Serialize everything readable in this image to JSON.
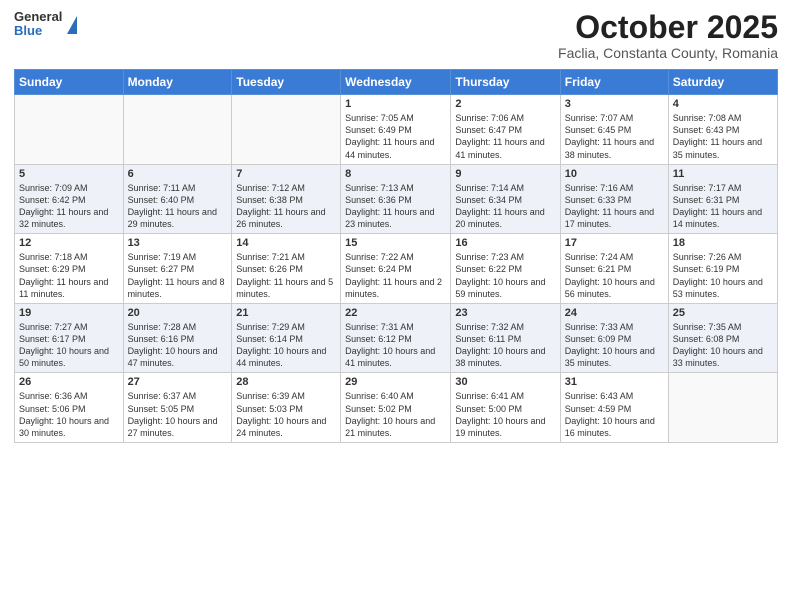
{
  "header": {
    "logo_general": "General",
    "logo_blue": "Blue",
    "title": "October 2025",
    "location": "Faclia, Constanta County, Romania"
  },
  "days_of_week": [
    "Sunday",
    "Monday",
    "Tuesday",
    "Wednesday",
    "Thursday",
    "Friday",
    "Saturday"
  ],
  "weeks": [
    {
      "days": [
        {
          "number": "",
          "sunrise": "",
          "sunset": "",
          "daylight": ""
        },
        {
          "number": "",
          "sunrise": "",
          "sunset": "",
          "daylight": ""
        },
        {
          "number": "",
          "sunrise": "",
          "sunset": "",
          "daylight": ""
        },
        {
          "number": "1",
          "sunrise": "Sunrise: 7:05 AM",
          "sunset": "Sunset: 6:49 PM",
          "daylight": "Daylight: 11 hours and 44 minutes."
        },
        {
          "number": "2",
          "sunrise": "Sunrise: 7:06 AM",
          "sunset": "Sunset: 6:47 PM",
          "daylight": "Daylight: 11 hours and 41 minutes."
        },
        {
          "number": "3",
          "sunrise": "Sunrise: 7:07 AM",
          "sunset": "Sunset: 6:45 PM",
          "daylight": "Daylight: 11 hours and 38 minutes."
        },
        {
          "number": "4",
          "sunrise": "Sunrise: 7:08 AM",
          "sunset": "Sunset: 6:43 PM",
          "daylight": "Daylight: 11 hours and 35 minutes."
        }
      ]
    },
    {
      "days": [
        {
          "number": "5",
          "sunrise": "Sunrise: 7:09 AM",
          "sunset": "Sunset: 6:42 PM",
          "daylight": "Daylight: 11 hours and 32 minutes."
        },
        {
          "number": "6",
          "sunrise": "Sunrise: 7:11 AM",
          "sunset": "Sunset: 6:40 PM",
          "daylight": "Daylight: 11 hours and 29 minutes."
        },
        {
          "number": "7",
          "sunrise": "Sunrise: 7:12 AM",
          "sunset": "Sunset: 6:38 PM",
          "daylight": "Daylight: 11 hours and 26 minutes."
        },
        {
          "number": "8",
          "sunrise": "Sunrise: 7:13 AM",
          "sunset": "Sunset: 6:36 PM",
          "daylight": "Daylight: 11 hours and 23 minutes."
        },
        {
          "number": "9",
          "sunrise": "Sunrise: 7:14 AM",
          "sunset": "Sunset: 6:34 PM",
          "daylight": "Daylight: 11 hours and 20 minutes."
        },
        {
          "number": "10",
          "sunrise": "Sunrise: 7:16 AM",
          "sunset": "Sunset: 6:33 PM",
          "daylight": "Daylight: 11 hours and 17 minutes."
        },
        {
          "number": "11",
          "sunrise": "Sunrise: 7:17 AM",
          "sunset": "Sunset: 6:31 PM",
          "daylight": "Daylight: 11 hours and 14 minutes."
        }
      ]
    },
    {
      "days": [
        {
          "number": "12",
          "sunrise": "Sunrise: 7:18 AM",
          "sunset": "Sunset: 6:29 PM",
          "daylight": "Daylight: 11 hours and 11 minutes."
        },
        {
          "number": "13",
          "sunrise": "Sunrise: 7:19 AM",
          "sunset": "Sunset: 6:27 PM",
          "daylight": "Daylight: 11 hours and 8 minutes."
        },
        {
          "number": "14",
          "sunrise": "Sunrise: 7:21 AM",
          "sunset": "Sunset: 6:26 PM",
          "daylight": "Daylight: 11 hours and 5 minutes."
        },
        {
          "number": "15",
          "sunrise": "Sunrise: 7:22 AM",
          "sunset": "Sunset: 6:24 PM",
          "daylight": "Daylight: 11 hours and 2 minutes."
        },
        {
          "number": "16",
          "sunrise": "Sunrise: 7:23 AM",
          "sunset": "Sunset: 6:22 PM",
          "daylight": "Daylight: 10 hours and 59 minutes."
        },
        {
          "number": "17",
          "sunrise": "Sunrise: 7:24 AM",
          "sunset": "Sunset: 6:21 PM",
          "daylight": "Daylight: 10 hours and 56 minutes."
        },
        {
          "number": "18",
          "sunrise": "Sunrise: 7:26 AM",
          "sunset": "Sunset: 6:19 PM",
          "daylight": "Daylight: 10 hours and 53 minutes."
        }
      ]
    },
    {
      "days": [
        {
          "number": "19",
          "sunrise": "Sunrise: 7:27 AM",
          "sunset": "Sunset: 6:17 PM",
          "daylight": "Daylight: 10 hours and 50 minutes."
        },
        {
          "number": "20",
          "sunrise": "Sunrise: 7:28 AM",
          "sunset": "Sunset: 6:16 PM",
          "daylight": "Daylight: 10 hours and 47 minutes."
        },
        {
          "number": "21",
          "sunrise": "Sunrise: 7:29 AM",
          "sunset": "Sunset: 6:14 PM",
          "daylight": "Daylight: 10 hours and 44 minutes."
        },
        {
          "number": "22",
          "sunrise": "Sunrise: 7:31 AM",
          "sunset": "Sunset: 6:12 PM",
          "daylight": "Daylight: 10 hours and 41 minutes."
        },
        {
          "number": "23",
          "sunrise": "Sunrise: 7:32 AM",
          "sunset": "Sunset: 6:11 PM",
          "daylight": "Daylight: 10 hours and 38 minutes."
        },
        {
          "number": "24",
          "sunrise": "Sunrise: 7:33 AM",
          "sunset": "Sunset: 6:09 PM",
          "daylight": "Daylight: 10 hours and 35 minutes."
        },
        {
          "number": "25",
          "sunrise": "Sunrise: 7:35 AM",
          "sunset": "Sunset: 6:08 PM",
          "daylight": "Daylight: 10 hours and 33 minutes."
        }
      ]
    },
    {
      "days": [
        {
          "number": "26",
          "sunrise": "Sunrise: 6:36 AM",
          "sunset": "Sunset: 5:06 PM",
          "daylight": "Daylight: 10 hours and 30 minutes."
        },
        {
          "number": "27",
          "sunrise": "Sunrise: 6:37 AM",
          "sunset": "Sunset: 5:05 PM",
          "daylight": "Daylight: 10 hours and 27 minutes."
        },
        {
          "number": "28",
          "sunrise": "Sunrise: 6:39 AM",
          "sunset": "Sunset: 5:03 PM",
          "daylight": "Daylight: 10 hours and 24 minutes."
        },
        {
          "number": "29",
          "sunrise": "Sunrise: 6:40 AM",
          "sunset": "Sunset: 5:02 PM",
          "daylight": "Daylight: 10 hours and 21 minutes."
        },
        {
          "number": "30",
          "sunrise": "Sunrise: 6:41 AM",
          "sunset": "Sunset: 5:00 PM",
          "daylight": "Daylight: 10 hours and 19 minutes."
        },
        {
          "number": "31",
          "sunrise": "Sunrise: 6:43 AM",
          "sunset": "Sunset: 4:59 PM",
          "daylight": "Daylight: 10 hours and 16 minutes."
        },
        {
          "number": "",
          "sunrise": "",
          "sunset": "",
          "daylight": ""
        }
      ]
    }
  ]
}
